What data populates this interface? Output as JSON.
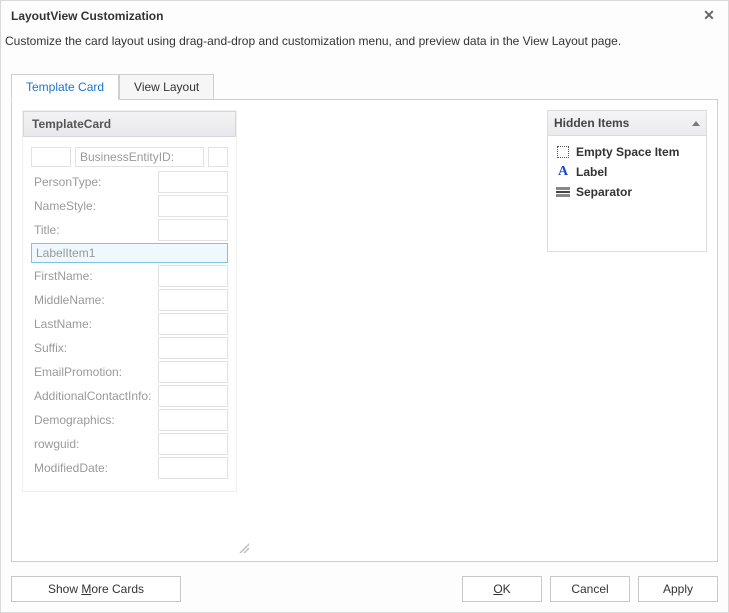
{
  "window": {
    "title": "LayoutView Customization",
    "instructions": "Customize the card layout using drag-and-drop and customization menu, and preview data in the View Layout page."
  },
  "tabs": [
    {
      "label": "Template Card",
      "active": true
    },
    {
      "label": "View Layout",
      "active": false
    }
  ],
  "card": {
    "header": "TemplateCard",
    "id_row_label": "BusinessEntityID:",
    "label_item": "LabelItem1",
    "fields_before": [
      "PersonType:",
      "NameStyle:",
      "Title:"
    ],
    "fields_after": [
      "FirstName:",
      "MiddleName:",
      "LastName:",
      "Suffix:",
      "EmailPromotion:",
      "AdditionalContactInfo:",
      "Demographics:",
      "rowguid:",
      "ModifiedDate:"
    ]
  },
  "hidden_panel": {
    "title": "Hidden Items",
    "items": [
      {
        "icon": "empty-space-icon",
        "label": "Empty Space Item"
      },
      {
        "icon": "label-icon",
        "label": "Label"
      },
      {
        "icon": "separator-icon",
        "label": "Separator"
      }
    ]
  },
  "footer": {
    "show_more": "Show More Cards",
    "show_more_mn": "M",
    "ok": "OK",
    "ok_mn": "O",
    "cancel": "Cancel",
    "apply": "Apply"
  }
}
